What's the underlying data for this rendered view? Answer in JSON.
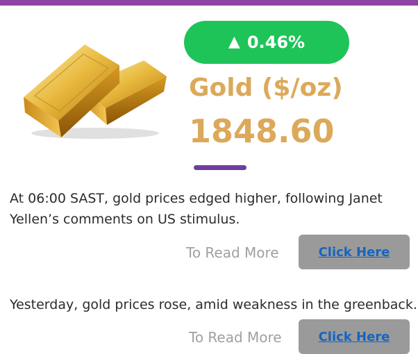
{
  "change": {
    "arrow_icon": "up-triangle-icon",
    "arrow_glyph": "▲",
    "percent": "0.46%",
    "color": "#1fc458"
  },
  "commodity": {
    "title": "Gold ($/oz)",
    "price": "1848.60",
    "color": "#dca95a"
  },
  "news": [
    {
      "text": "At 06:00 SAST, gold prices edged higher, following Janet Yellen’s comments on US stimulus.",
      "read_more": "To Read More",
      "button": "Click Here"
    },
    {
      "text": "Yesterday, gold prices rose, amid weakness in the greenback.",
      "read_more": "To Read More",
      "button": "Click Here"
    }
  ],
  "colors": {
    "accent_top": "#8e44a4",
    "divider": "#6d3ea0",
    "link": "#1565c0",
    "button_bg": "#9a9a9a"
  }
}
